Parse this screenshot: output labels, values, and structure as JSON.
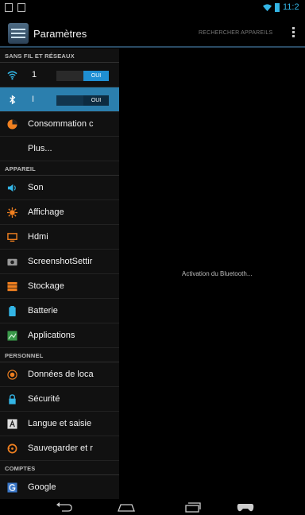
{
  "status": {
    "time": "11:2"
  },
  "header": {
    "title": "Paramètres",
    "search_label": "RECHERCHER APPAREILS"
  },
  "sections": {
    "wireless": "SANS FIL ET RÉSEAUX",
    "device": "APPAREIL",
    "personal": "PERSONNEL",
    "accounts": "COMPTES"
  },
  "items": {
    "wifi": {
      "label": "1",
      "toggle": "OUI"
    },
    "bluetooth": {
      "label": "I",
      "toggle": "OUI"
    },
    "data": "Consommation c",
    "more": "Plus...",
    "sound": "Son",
    "display": "Affichage",
    "hdmi": "Hdmi",
    "screenshot": "ScreenshotSettir",
    "storage": "Stockage",
    "battery": "Batterie",
    "apps": "Applications",
    "location": "Données de loca",
    "security": "Sécurité",
    "language": "Langue et saisie",
    "backup": "Sauvegarder et r",
    "google": "Google"
  },
  "content": {
    "message": "Activation du Bluetooth..."
  },
  "colors": {
    "accent": "#33b5e5",
    "selected": "#2b7fae"
  }
}
